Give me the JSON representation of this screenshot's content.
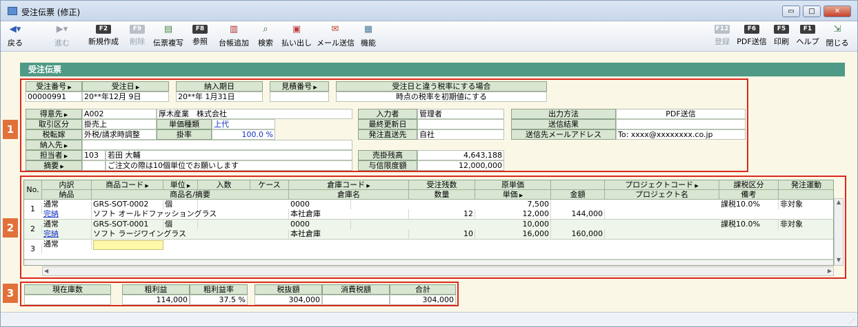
{
  "window": {
    "title": "受注伝票 (修正)",
    "min": "▭",
    "max": "□",
    "close": "✕"
  },
  "toolbar": {
    "back": "戻る",
    "forward": "進む",
    "new": "新規作成",
    "delete": "削除",
    "copy": "伝票複写",
    "ref": "参照",
    "ledger": "台帳追加",
    "search": "検索",
    "dispatch": "払い出し",
    "mail": "メール送信",
    "func": "機能",
    "register": "登録",
    "pdf": "PDF送信",
    "print": "印刷",
    "help": "ヘルプ",
    "closewin": "閉じる",
    "f2": "F2",
    "f9": "F9",
    "f8": "F8",
    "f12": "F12",
    "f6": "F6",
    "f5": "F5",
    "f1": "F1"
  },
  "banner": "受注伝票",
  "badges": [
    "1",
    "2",
    "3"
  ],
  "header": {
    "order_no_label": "受注番号",
    "order_no": "00000991",
    "order_date_label": "受注日",
    "order_date": "20**年12月 9日",
    "delivery_label": "納入期日",
    "delivery": "20**年 1月31日",
    "estimate_label": "見積番号",
    "estimate": "",
    "tax_label": "受注日と違う税率にする場合",
    "tax_value": "時点の税率を初期値にする"
  },
  "customer": {
    "tokui_label": "得意先",
    "tokui_code": "A002",
    "tokui_name": "厚木産業　株式会社",
    "torihiki_label": "取引区分",
    "torihiki": "掛売上",
    "tanka_label": "単価種類",
    "tanka": "上代",
    "zeiten_label": "税転嫁",
    "zeiten": "外税/請求時調整",
    "kakeritsu_label": "掛率",
    "kakeritsu": "100.0 %",
    "nounyu_label": "納入先",
    "nounyu": "",
    "tantou_label": "担当者",
    "tantou_code": "103",
    "tantou_name": "若田 大輔",
    "tekiyou_label": "摘要",
    "tekiyou": "ご注文の際は10個単位でお願いします"
  },
  "mid": {
    "nyuryoku_label": "入力者",
    "nyuryoku": "管理者",
    "koushin_label": "最終更新日",
    "koushin": "",
    "hacchu_label": "発注直送先",
    "hacchu": "自社",
    "urikake_label": "売掛残高",
    "urikake": "4,643,188",
    "yoshin_label": "与信限度額",
    "yoshin": "12,000,000"
  },
  "right": {
    "output_label": "出力方法",
    "output": "PDF送信",
    "result_label": "送信結果",
    "result": "",
    "mail_label": "送信先メールアドレス",
    "mail": "To: xxxx@xxxxxxxx.co.jp"
  },
  "grid": {
    "h1": [
      "No.",
      "内訳",
      "商品コード",
      "単位",
      "入数",
      "ケース",
      "倉庫コード",
      "受注残数",
      "原単価",
      "",
      "プロジェクトコード",
      "課税区分",
      "発注運動"
    ],
    "h2": [
      "納品",
      "商品名/摘要",
      "倉庫名",
      "数量",
      "単価",
      "金額",
      "プロジェクト名",
      "備考"
    ],
    "rows": [
      {
        "no": "1",
        "uchiwake": "通常",
        "nohin": "完納",
        "code": "GRS-SOT-0002",
        "unit": "個",
        "name": "ソフト オールドファッショングラス",
        "wh_code": "0000",
        "wh_name": "本社倉庫",
        "qty": "12",
        "genka": "7,500",
        "tanka": "12,000",
        "kingaku": "144,000",
        "tax": "課税10.0%",
        "hacchu": "非対象"
      },
      {
        "no": "2",
        "uchiwake": "通常",
        "nohin": "完納",
        "code": "GRS-SOT-0001",
        "unit": "個",
        "name": "ソフト ラージワイングラス",
        "wh_code": "0000",
        "wh_name": "本社倉庫",
        "qty": "10",
        "genka": "10,000",
        "tanka": "16,000",
        "kingaku": "160,000",
        "tax": "課税10.0%",
        "hacchu": "非対象"
      },
      {
        "no": "3",
        "uchiwake": "通常",
        "nohin": "",
        "code": "",
        "unit": "",
        "name": "",
        "wh_code": "",
        "wh_name": "",
        "qty": "",
        "genka": "",
        "tanka": "",
        "kingaku": "",
        "tax": "",
        "hacchu": ""
      }
    ]
  },
  "totals": {
    "stock_label": "現在庫数",
    "stock": "",
    "profit_label": "粗利益",
    "profit": "114,000",
    "rate_label": "粗利益率",
    "rate": "37.5 %",
    "net_label": "税抜額",
    "net": "304,000",
    "tax_label": "消費税額",
    "tax": "",
    "total_label": "合計",
    "total": "304,000"
  },
  "colors": {
    "banner": "#4f9a86",
    "highlight": "#d9281c",
    "badge": "#e0713a",
    "header_cell": "#d8e6d2"
  }
}
